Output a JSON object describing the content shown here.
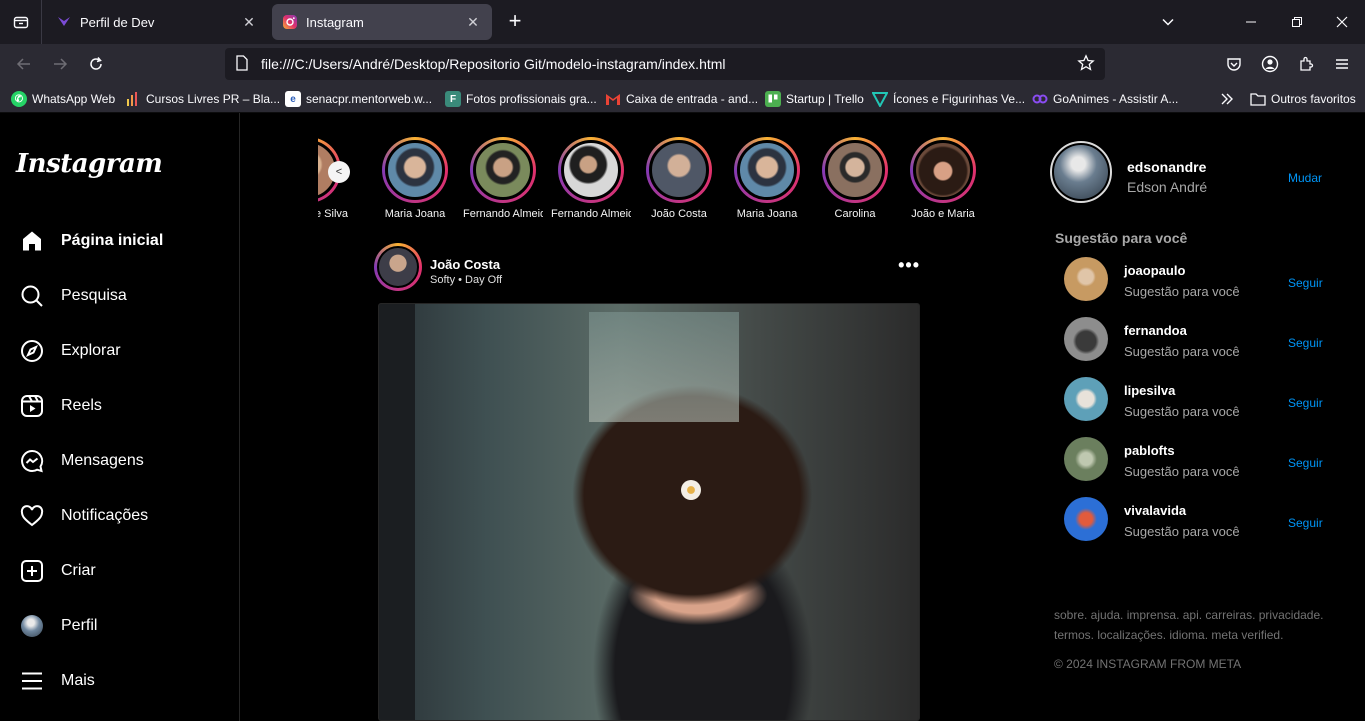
{
  "browser": {
    "tabs": [
      {
        "title": "Perfil de Dev",
        "active": false
      },
      {
        "title": "Instagram",
        "active": true
      }
    ],
    "url": "file:///C:/Users/André/Desktop/Repositorio Git/modelo-instagram/index.html",
    "bookmarks": [
      {
        "label": "WhatsApp Web",
        "icon": "whatsapp-icon",
        "color": "#25d366"
      },
      {
        "label": "Cursos Livres PR – Bla...",
        "icon": "bar-chart-icon",
        "color": "#f2c94c"
      },
      {
        "label": "senacpr.mentorweb.w...",
        "icon": "e-icon",
        "color": "#2d5fb9"
      },
      {
        "label": "Fotos profissionais gra...",
        "icon": "photo-icon",
        "color": "#3a8a7a"
      },
      {
        "label": "Caixa de entrada - and...",
        "icon": "gmail-icon",
        "color": "#ea4335"
      },
      {
        "label": "Startup | Trello",
        "icon": "trello-icon",
        "color": "#4caf50"
      },
      {
        "label": "Ícones e Figurinhas Ve...",
        "icon": "vector-icon",
        "color": "#22c6b5"
      },
      {
        "label": "GoAnimes - Assistir A...",
        "icon": "goanimes-icon",
        "color": "#8a4cf2"
      }
    ],
    "other_bookmarks": "Outros favoritos"
  },
  "sidebar": {
    "logo": "Instagram",
    "items": [
      {
        "label": "Página inicial",
        "icon": "home-icon"
      },
      {
        "label": "Pesquisa",
        "icon": "search-icon"
      },
      {
        "label": "Explorar",
        "icon": "compass-icon"
      },
      {
        "label": "Reels",
        "icon": "reels-icon"
      },
      {
        "label": "Mensagens",
        "icon": "messenger-icon"
      },
      {
        "label": "Notificações",
        "icon": "heart-icon"
      },
      {
        "label": "Criar",
        "icon": "plus-square-icon"
      },
      {
        "label": "Perfil",
        "icon": "profile-avatar-icon"
      },
      {
        "label": "Mais",
        "icon": "menu-icon"
      }
    ]
  },
  "stories": [
    {
      "name": "Felipe Silva",
      "color": "#b07d62"
    },
    {
      "name": "Maria Joana",
      "color": "#5f89a8"
    },
    {
      "name": "Fernando Almeida",
      "color": "#7a8a5c"
    },
    {
      "name": "Fernando Almeida",
      "color": "#8a8a8a"
    },
    {
      "name": "João Costa",
      "color": "#4f5766"
    },
    {
      "name": "Maria Joana",
      "color": "#5f89a8"
    },
    {
      "name": "Carolina",
      "color": "#8a7060"
    },
    {
      "name": "João e Maria",
      "color": "#6b4a3a"
    }
  ],
  "post": {
    "username": "João Costa",
    "subtitle": "Softy • Day Off",
    "more": "•••"
  },
  "right": {
    "me": {
      "username": "edsonandre",
      "name": "Edson André",
      "switch": "Mudar"
    },
    "suggestions_title": "Sugestão para você",
    "suggestions": [
      {
        "username": "joaopaulo",
        "sub": "Sugestão para você",
        "action": "Seguir",
        "color": "#c79a62"
      },
      {
        "username": "fernandoa",
        "sub": "Sugestão para você",
        "action": "Seguir",
        "color": "#8d8d8d"
      },
      {
        "username": "lipesilva",
        "sub": "Sugestão para você",
        "action": "Seguir",
        "color": "#5ea0b8"
      },
      {
        "username": "pablofts",
        "sub": "Sugestão para você",
        "action": "Seguir",
        "color": "#6b7f5e"
      },
      {
        "username": "vivalavida",
        "sub": "Sugestão para você",
        "action": "Seguir",
        "color": "#2c6fd6"
      }
    ],
    "footer_links": "sobre. ajuda. imprensa. api. carreiras. privacidade. termos. localizações. idioma. meta verified.",
    "copyright": "© 2024 INSTAGRAM FROM META"
  }
}
